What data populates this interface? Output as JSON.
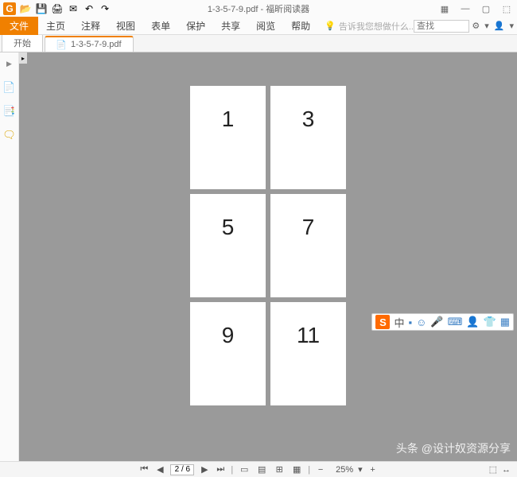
{
  "title": {
    "filename": "1-3-5-7-9.pdf",
    "appname": "福昕阅读器",
    "separator": " - "
  },
  "qat": {
    "open": "📂",
    "save": "💾",
    "print": "🖨",
    "email": "✉",
    "undo": "↶",
    "redo": "↷"
  },
  "window_controls": {
    "grid": "▦",
    "min": "—",
    "max": "▢",
    "close": "⬚"
  },
  "menu": {
    "file": "文件",
    "home": "主页",
    "annotate": "注释",
    "view": "视图",
    "form": "表单",
    "protect": "保护",
    "share": "共享",
    "read": "阅览",
    "help": "帮助",
    "prompt": "告诉我您想做什么...",
    "search_placeholder": "查找",
    "settings": "⚙",
    "user": "👤"
  },
  "tabs": {
    "start": "开始",
    "active": "1-3-5-7-9.pdf"
  },
  "sidebar": {
    "collapse": "▶",
    "page_icon": "📄",
    "copy_icon": "📑",
    "note_icon": "🗨"
  },
  "pages": [
    "1",
    "3",
    "5",
    "7",
    "9",
    "11"
  ],
  "ime": {
    "logo": "S",
    "lang": "中",
    "punct": "▪",
    "face": "☺",
    "mic": "🎤",
    "keyb": "⌨",
    "user": "👤",
    "shirt": "👕",
    "grid": "▦"
  },
  "watermark": "头条 @设计奴资源分享",
  "status": {
    "first": "⏮",
    "prev": "◀",
    "page_input": "2 / 6",
    "next": "▶",
    "last": "⏭",
    "view1": "▭",
    "view2": "▤",
    "view3": "⊞",
    "view4": "▦",
    "zoom_out": "−",
    "zoom": "25%",
    "zoom_in": "+",
    "fit1": "⬚",
    "fit2": "↔"
  }
}
